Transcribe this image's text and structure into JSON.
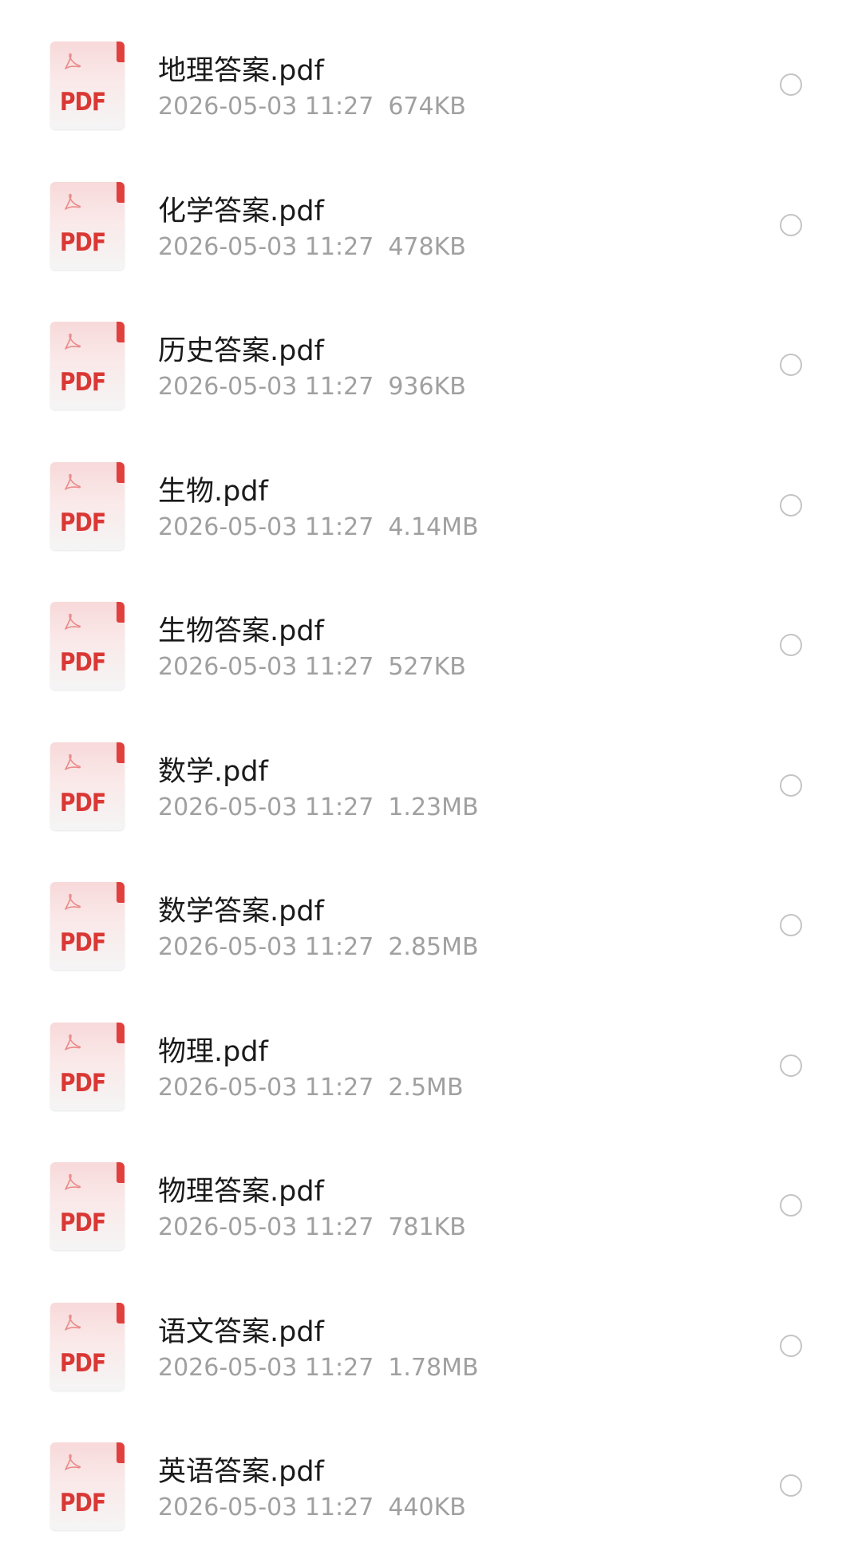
{
  "files": [
    {
      "name": "地理答案.pdf",
      "date": "2026-05-03 11:27",
      "size": "674KB",
      "icon": "pdf-file-icon",
      "label": "PDF"
    },
    {
      "name": "化学答案.pdf",
      "date": "2026-05-03 11:27",
      "size": "478KB",
      "icon": "pdf-file-icon",
      "label": "PDF"
    },
    {
      "name": "历史答案.pdf",
      "date": "2026-05-03 11:27",
      "size": "936KB",
      "icon": "pdf-file-icon",
      "label": "PDF"
    },
    {
      "name": "生物.pdf",
      "date": "2026-05-03 11:27",
      "size": "4.14MB",
      "icon": "pdf-file-icon",
      "label": "PDF"
    },
    {
      "name": "生物答案.pdf",
      "date": "2026-05-03 11:27",
      "size": "527KB",
      "icon": "pdf-file-icon",
      "label": "PDF"
    },
    {
      "name": "数学.pdf",
      "date": "2026-05-03 11:27",
      "size": "1.23MB",
      "icon": "pdf-file-icon",
      "label": "PDF"
    },
    {
      "name": "数学答案.pdf",
      "date": "2026-05-03 11:27",
      "size": "2.85MB",
      "icon": "pdf-file-icon",
      "label": "PDF"
    },
    {
      "name": "物理.pdf",
      "date": "2026-05-03 11:27",
      "size": "2.5MB",
      "icon": "pdf-file-icon",
      "label": "PDF"
    },
    {
      "name": "物理答案.pdf",
      "date": "2026-05-03 11:27",
      "size": "781KB",
      "icon": "pdf-file-icon",
      "label": "PDF"
    },
    {
      "name": "语文答案.pdf",
      "date": "2026-05-03 11:27",
      "size": "1.78MB",
      "icon": "pdf-file-icon",
      "label": "PDF"
    },
    {
      "name": "英语答案.pdf",
      "date": "2026-05-03 11:27",
      "size": "440KB",
      "icon": "pdf-file-icon",
      "label": "PDF"
    }
  ],
  "colors": {
    "pdf_red": "#d93835",
    "name_text": "#1a1a1a",
    "meta_text": "#a0a0a0",
    "radio_border": "#c4c4c4"
  }
}
